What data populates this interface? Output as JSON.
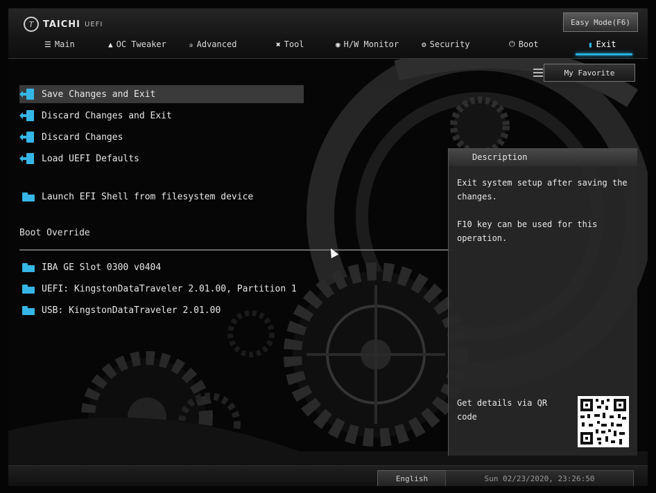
{
  "header": {
    "logo_text": "TAICHI",
    "logo_sub": "UEFI",
    "easy_mode_label": "Easy Mode(F6)"
  },
  "tabs": [
    {
      "label": "Main",
      "icon": "list-icon"
    },
    {
      "label": "OC Tweaker",
      "icon": "rocket-icon"
    },
    {
      "label": "Advanced",
      "icon": "star-icon"
    },
    {
      "label": "Tool",
      "icon": "tools-icon"
    },
    {
      "label": "H/W Monitor",
      "icon": "monitor-icon"
    },
    {
      "label": "Security",
      "icon": "shield-icon"
    },
    {
      "label": "Boot",
      "icon": "power-icon"
    },
    {
      "label": "Exit",
      "icon": "exit-icon",
      "active": true
    }
  ],
  "favorite_label": "My Favorite",
  "menu": {
    "items": [
      {
        "label": "Save Changes and Exit",
        "icon": "exit-icon"
      },
      {
        "label": "Discard Changes and Exit",
        "icon": "exit-icon"
      },
      {
        "label": "Discard Changes",
        "icon": "exit-icon"
      },
      {
        "label": "Load UEFI Defaults",
        "icon": "exit-icon"
      },
      {
        "label": "Launch EFI Shell from filesystem device",
        "icon": "folder-icon"
      }
    ],
    "boot_override_heading": "Boot Override",
    "boot_items": [
      {
        "label": "IBA GE Slot 0300 v0404",
        "icon": "folder-icon"
      },
      {
        "label": "UEFI: KingstonDataTraveler 2.01.00, Partition 1",
        "icon": "folder-icon"
      },
      {
        "label": "USB: KingstonDataTraveler 2.01.00",
        "icon": "folder-icon"
      }
    ]
  },
  "description": {
    "title": "Description",
    "paragraphs": [
      "Exit system setup after saving the changes.",
      "F10 key can be used for this operation."
    ],
    "qr_text": "Get details via QR code"
  },
  "footer": {
    "language": "English",
    "datetime": "Sun 02/23/2020, 23:26:50"
  },
  "colors": {
    "accent": "#27b1e0",
    "background": "#060606",
    "selection": "#3a3a3a"
  }
}
